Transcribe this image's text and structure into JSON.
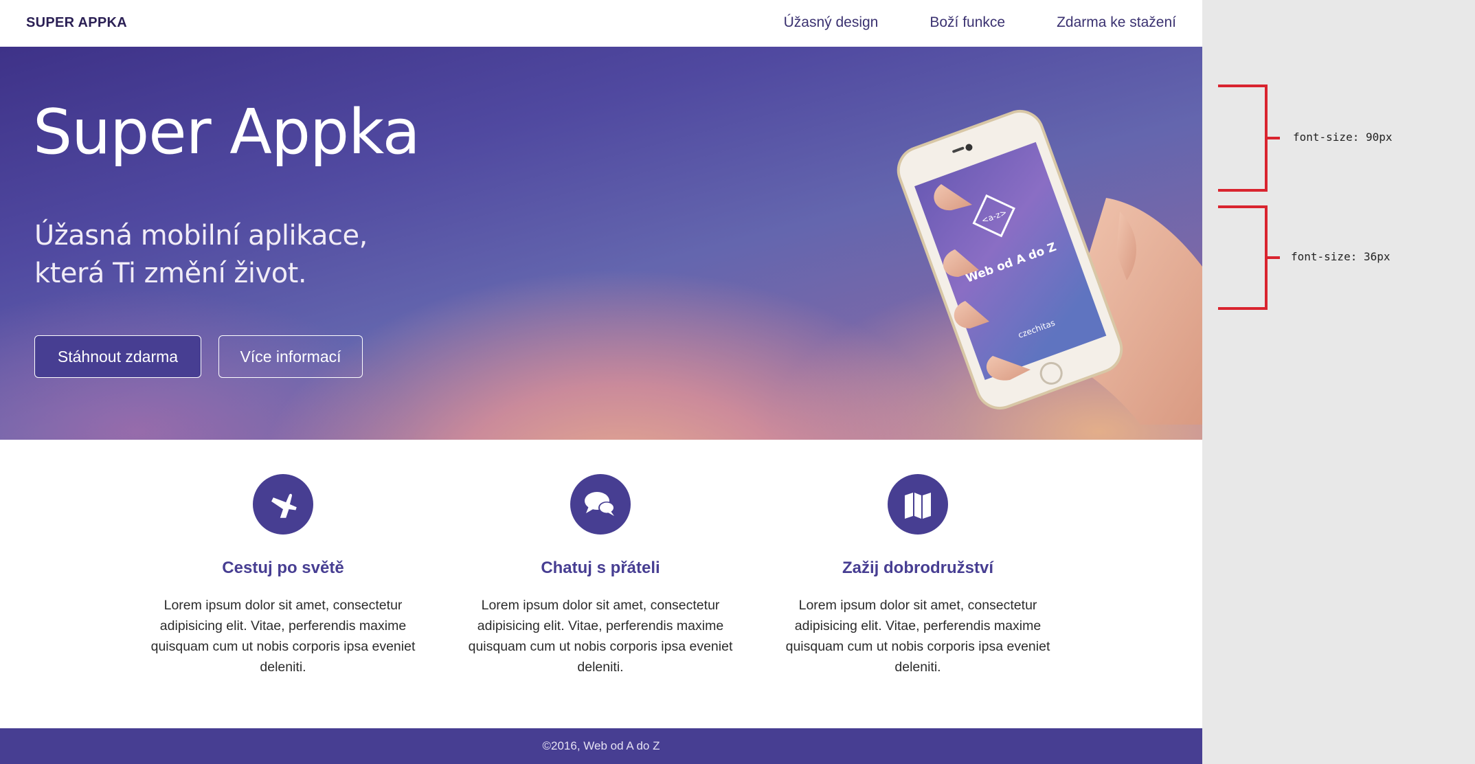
{
  "nav": {
    "brand": "SUPER APPKA",
    "links": [
      "Úžasný design",
      "Boží funkce",
      "Zdarma ke stažení"
    ]
  },
  "hero": {
    "title": "Super Appka",
    "subtitle_line1": "Úžasná mobilní aplikace,",
    "subtitle_line2": "která Ti změní život.",
    "buttons": {
      "primary": "Stáhnout zdarma",
      "secondary": "Více informací"
    },
    "phone_screen": {
      "logo_text": "<a-z>",
      "app_name": "Web od A do Z",
      "partner": "czechitas"
    }
  },
  "features": [
    {
      "icon": "airplane-icon",
      "title": "Cestuj po světě",
      "text": "Lorem ipsum dolor sit amet, consectetur adipisicing elit. Vitae, perferendis maxime quisquam cum ut nobis corporis ipsa eveniet deleniti."
    },
    {
      "icon": "chat-bubbles-icon",
      "title": "Chatuj s přáteli",
      "text": "Lorem ipsum dolor sit amet, consectetur adipisicing elit. Vitae, perferendis maxime quisquam cum ut nobis corporis ipsa eveniet deleniti."
    },
    {
      "icon": "map-icon",
      "title": "Zažij dobrodružství",
      "text": "Lorem ipsum dolor sit amet, consectetur adipisicing elit. Vitae, perferendis maxime quisquam cum ut nobis corporis ipsa eveniet deleniti."
    }
  ],
  "footer": {
    "text": "©2016, Web od A do Z"
  },
  "annotations": {
    "title_font": "font-size: 90px",
    "subtitle_font": "font-size: 36px"
  },
  "colors": {
    "accent": "#473e92",
    "annotation_bracket": "#d9242f",
    "sidebar_bg": "#e8e8e8"
  }
}
